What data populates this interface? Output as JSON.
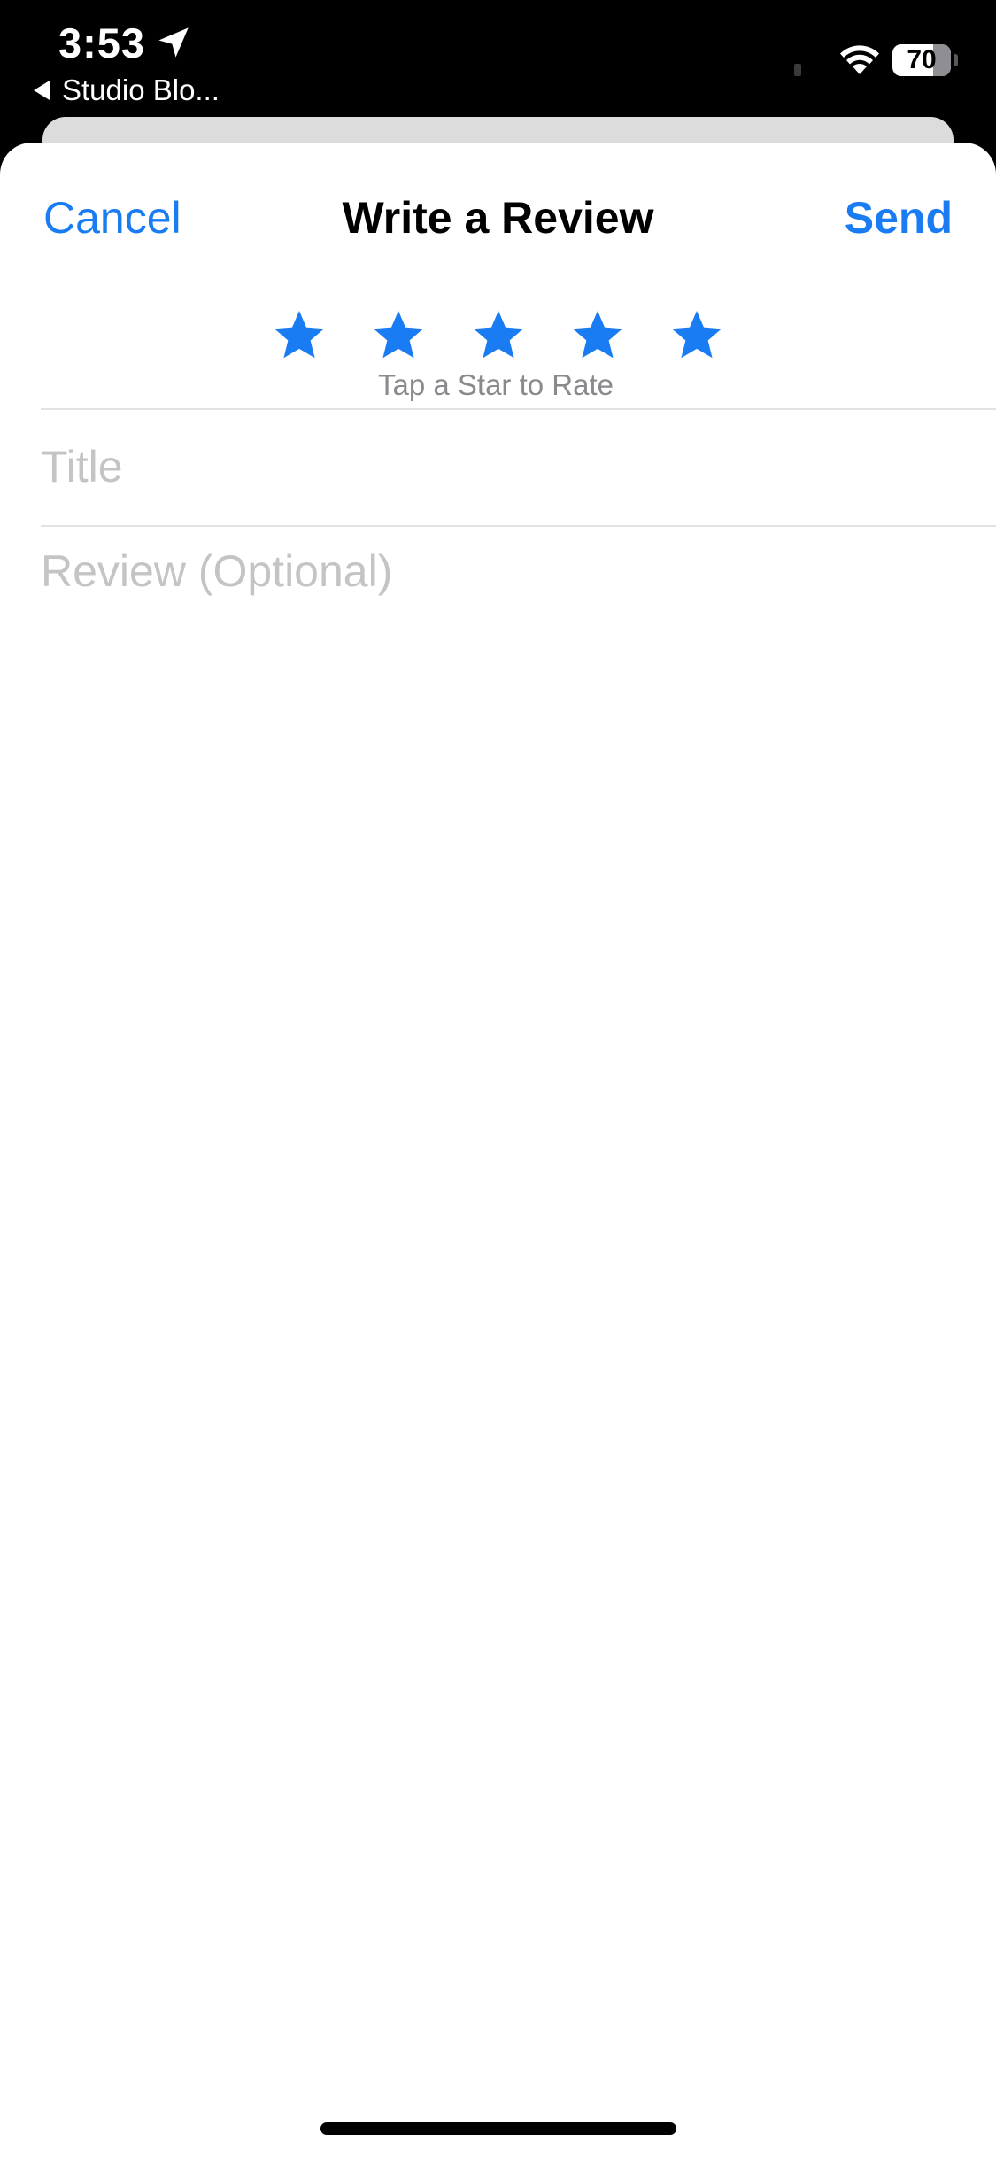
{
  "status_bar": {
    "time": "3:53",
    "location_icon": "location-arrow-icon",
    "back_app_label": "Studio Blo...",
    "back_icon": "back-triangle-icon",
    "wifi_icon": "wifi-icon",
    "battery_level": "70",
    "battery_fraction": 0.7
  },
  "nav": {
    "cancel_label": "Cancel",
    "title": "Write a Review",
    "send_label": "Send"
  },
  "rating": {
    "max_stars": 5,
    "star_icon": "star-icon",
    "hint": "Tap a Star to Rate"
  },
  "form": {
    "title_placeholder": "Title",
    "title_value": "",
    "review_placeholder": "Review (Optional)",
    "review_value": ""
  },
  "colors": {
    "accent": "#1a7cf2",
    "placeholder": "#c4c4c6",
    "hint": "#8a8a8e",
    "status_bar_bg": "#000000"
  }
}
